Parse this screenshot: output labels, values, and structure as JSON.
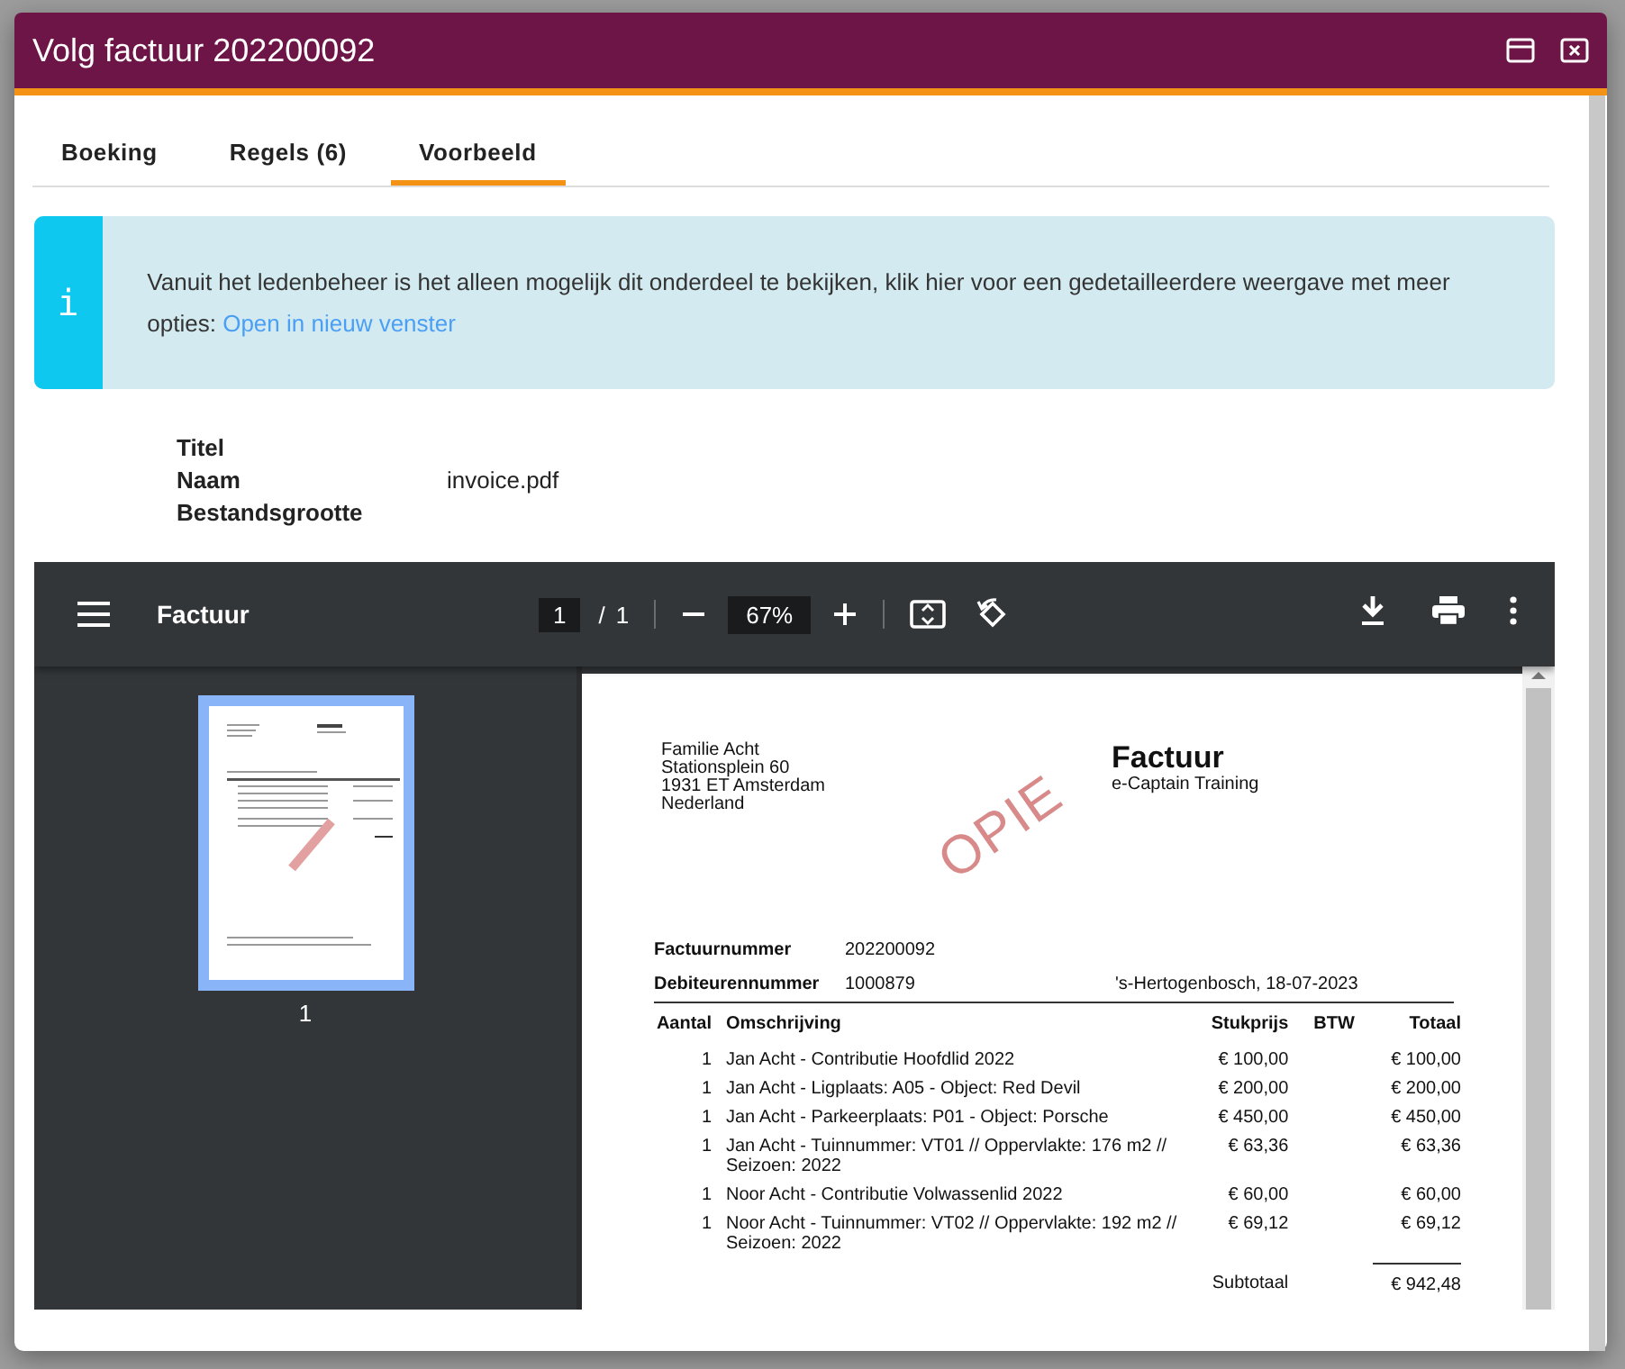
{
  "window": {
    "title": "Volg factuur 202200092"
  },
  "tabs": [
    {
      "label": "Boeking",
      "selected": false
    },
    {
      "label": "Regels (6)",
      "selected": false
    },
    {
      "label": "Voorbeeld",
      "selected": true
    }
  ],
  "info": {
    "icon_glyph": "i",
    "text": "Vanuit het ledenbeheer is het alleen mogelijk dit onderdeel te bekijken, klik hier voor een gedetailleerdere weergave met meer opties:",
    "link": "Open in nieuw venster"
  },
  "properties": [
    {
      "label": "Titel"
    },
    {
      "label": "Naam",
      "value": "invoice.pdf"
    },
    {
      "label": "Bestandsgrootte"
    }
  ],
  "pdf_viewer": {
    "title": "Factuur",
    "page": "1",
    "separator": "/",
    "page_count": "1",
    "zoom": "67%",
    "thumbnails": [
      {
        "label": "1",
        "selected": true
      }
    ],
    "document": {
      "address": [
        "Familie Acht",
        "Stationsplein 60",
        "1931 ET Amsterdam",
        "Nederland"
      ],
      "heading": "Factuur",
      "company": "e-Captain Training",
      "meta": [
        {
          "label": "Factuurnummer",
          "value": "202200092"
        },
        {
          "label": "Debiteurennummer",
          "value": "1000879",
          "note": "'s-Hertogenbosch, 18-07-2023"
        }
      ],
      "columns": [
        "Aantal",
        "Omschrijving",
        "Stukprijs",
        "BTW",
        "Totaal"
      ],
      "rows": [
        {
          "quantity": "1",
          "description": "Jan Acht - Contributie Hoofdlid 2022",
          "unit_price": "€ 100,00",
          "total": "€ 100,00"
        },
        {
          "quantity": "1",
          "description": "Jan Acht - Ligplaats: A05 - Object: Red Devil",
          "unit_price": "€ 200,00",
          "total": "€ 200,00"
        },
        {
          "quantity": "1",
          "description": "Jan Acht - Parkeerplaats: P01 - Object: Porsche",
          "unit_price": "€ 450,00",
          "total": "€ 450,00"
        },
        {
          "quantity": "1",
          "description": "Jan Acht - Tuinnummer: VT01 // Oppervlakte: 176 m2 // Seizoen: 2022",
          "unit_price": "€ 63,36",
          "total": "€ 63,36"
        },
        {
          "quantity": "1",
          "description": "Noor Acht - Contributie Volwassenlid 2022",
          "unit_price": "€ 60,00",
          "total": "€ 60,00"
        },
        {
          "quantity": "1",
          "description": "Noor Acht - Tuinnummer: VT02 // Oppervlakte: 192 m2 // Seizoen: 2022",
          "unit_price": "€ 69,12",
          "total": "€ 69,12"
        }
      ],
      "subtotal": {
        "label": "Subtotaal",
        "value": "€ 942,48"
      },
      "stamp": "OPIE"
    }
  }
}
